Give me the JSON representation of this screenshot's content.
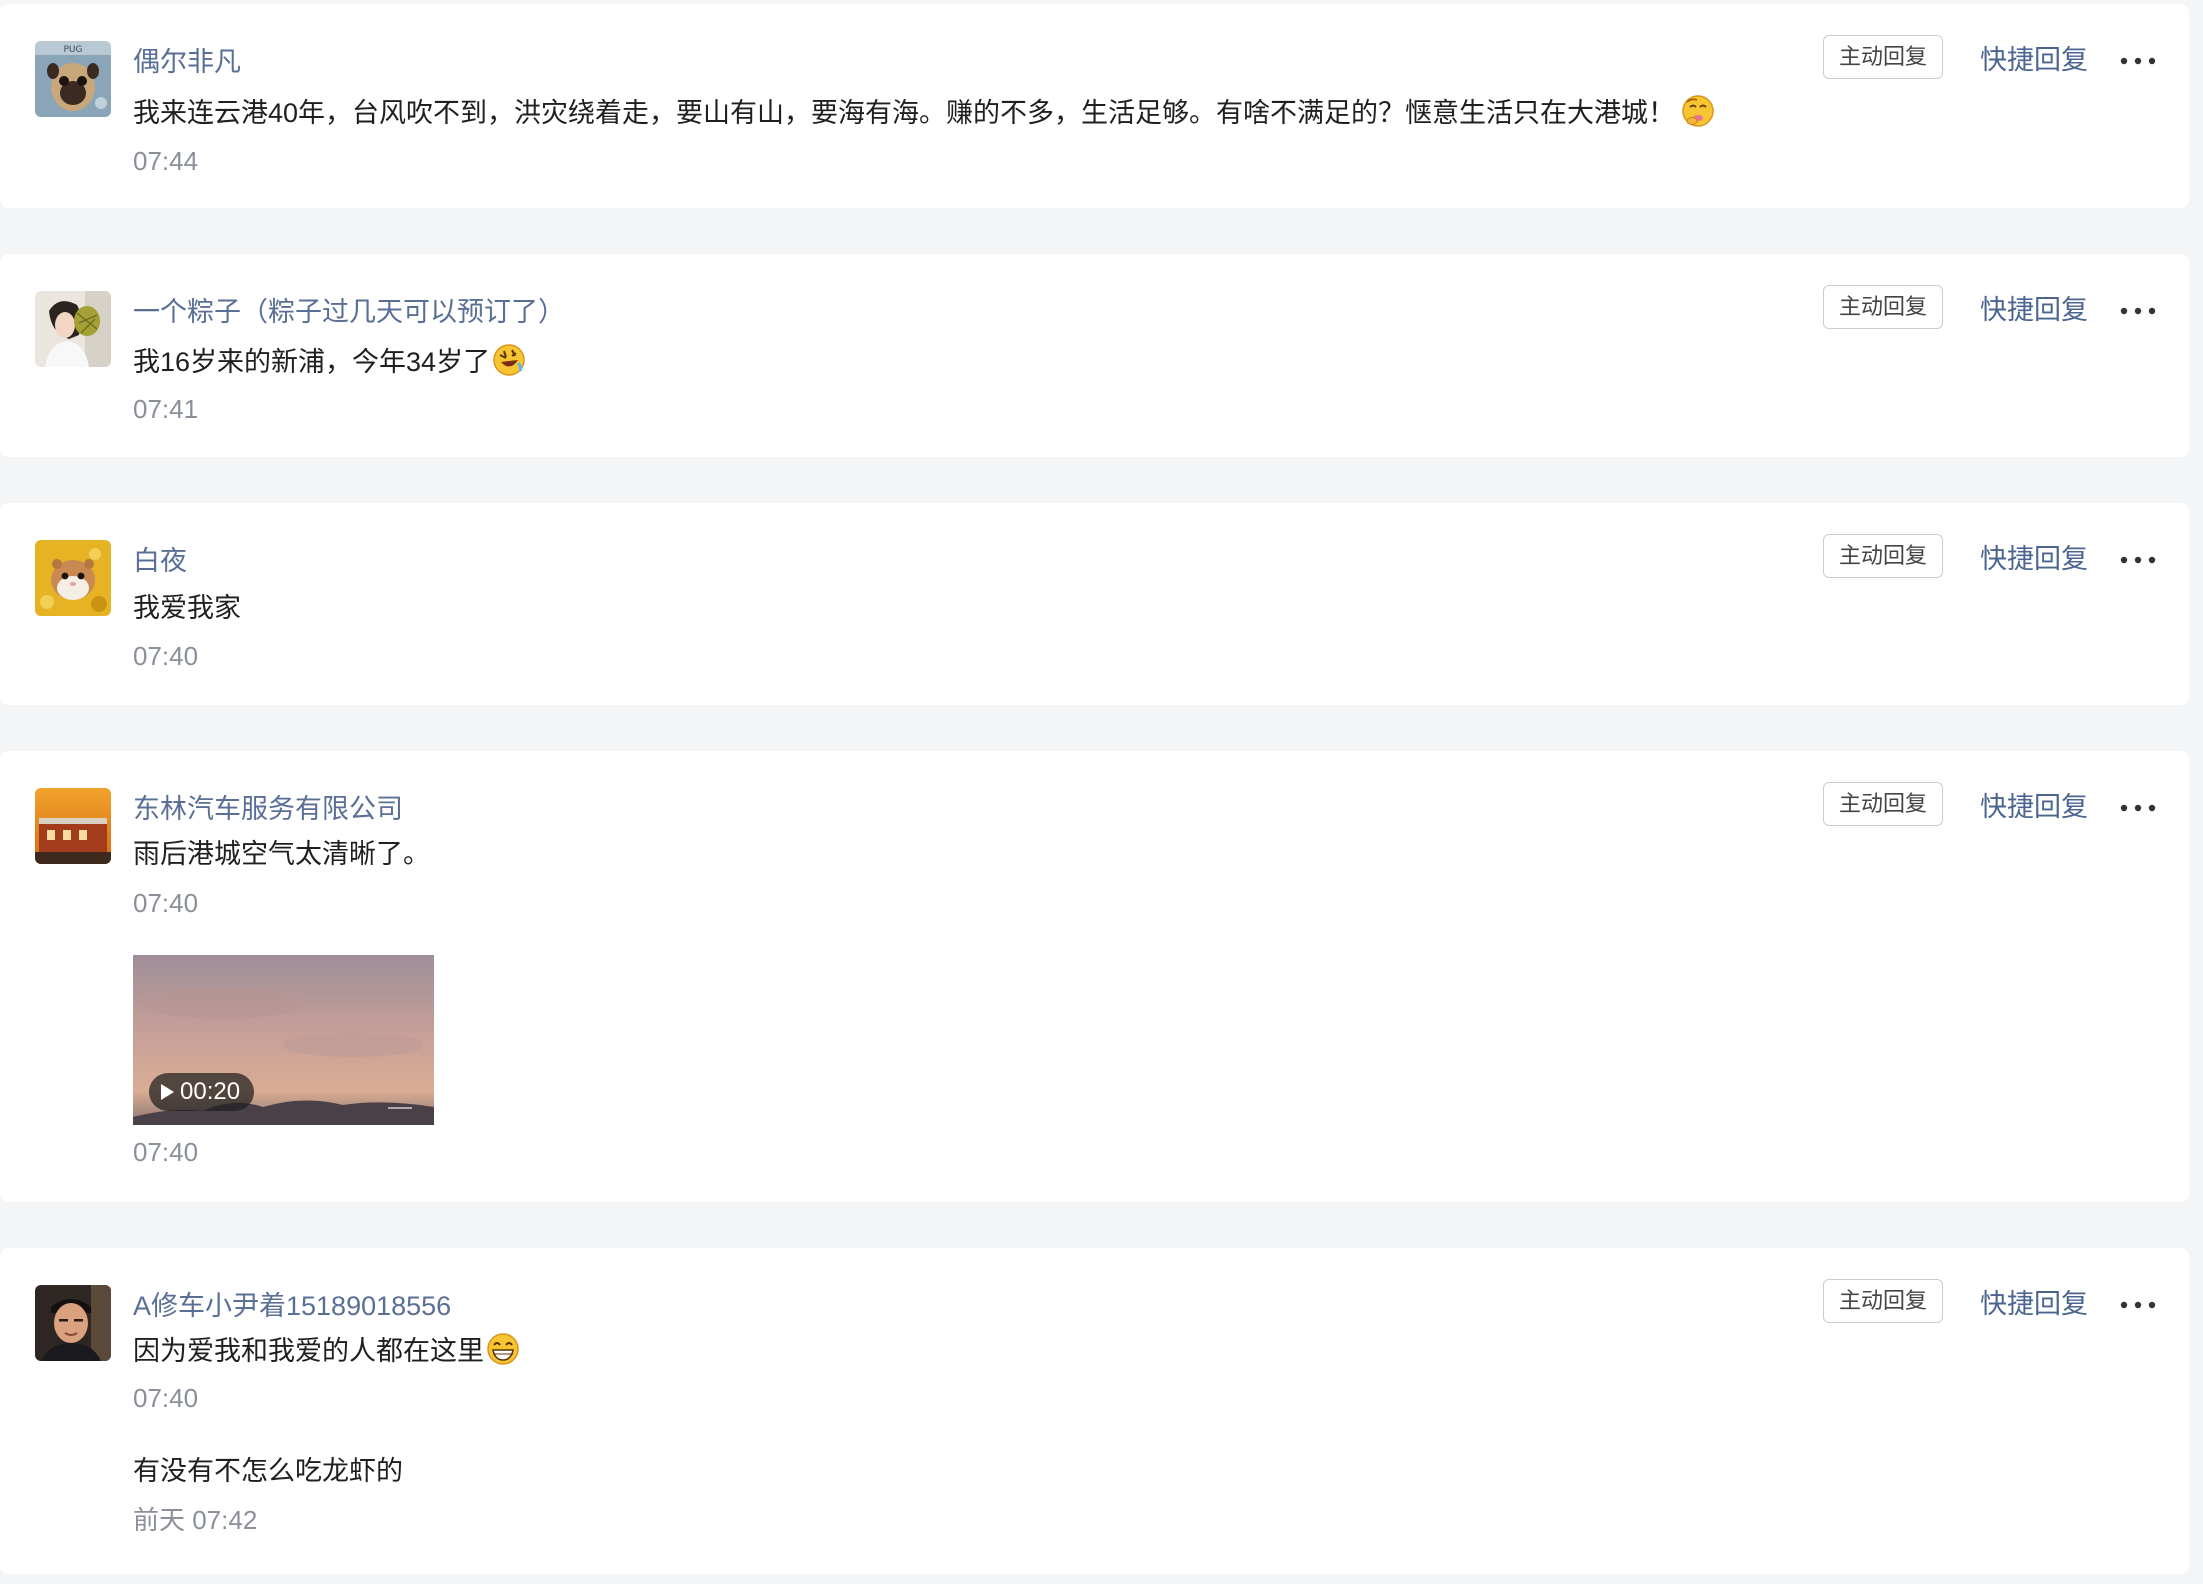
{
  "actions": {
    "active_reply": "主动回复",
    "quick_reply": "快捷回复",
    "more": "..."
  },
  "comments": [
    {
      "name": "偶尔非凡",
      "avatar": "pug-photo",
      "messages": [
        {
          "text": "我来连云港40年，台风吹不到，洪灾绕着走，要山有山，要海有海。赚的不多，生活足够。有啥不满足的？惬意生活只在大港城！",
          "emoji": "smirk-shush-emoji",
          "time": "07:44"
        }
      ]
    },
    {
      "name": "一个粽子（粽子过几天可以预订了）",
      "avatar": "woman-with-durian-photo",
      "messages": [
        {
          "text": "我16岁来的新浦，今年34岁了",
          "emoji": "rolling-laugh-emoji",
          "time": "07:41"
        }
      ]
    },
    {
      "name": "白夜",
      "avatar": "hamster-photo",
      "messages": [
        {
          "text": "我爱我家",
          "time": "07:40"
        }
      ]
    },
    {
      "name": "东林汽车服务有限公司",
      "avatar": "building-sunset-photo",
      "messages": [
        {
          "text": "雨后港城空气太清晰了。",
          "time": "07:40"
        }
      ],
      "video": {
        "duration": "00:20",
        "time": "07:40"
      }
    },
    {
      "name": "A修车小尹着15189018556",
      "avatar": "man-portrait-photo",
      "messages": [
        {
          "text": "因为爱我和我爱的人都在这里",
          "emoji": "grin-emoji",
          "time": "07:40"
        },
        {
          "text": "有没有不怎么吃龙虾的",
          "time": "前天 07:42"
        }
      ]
    }
  ]
}
